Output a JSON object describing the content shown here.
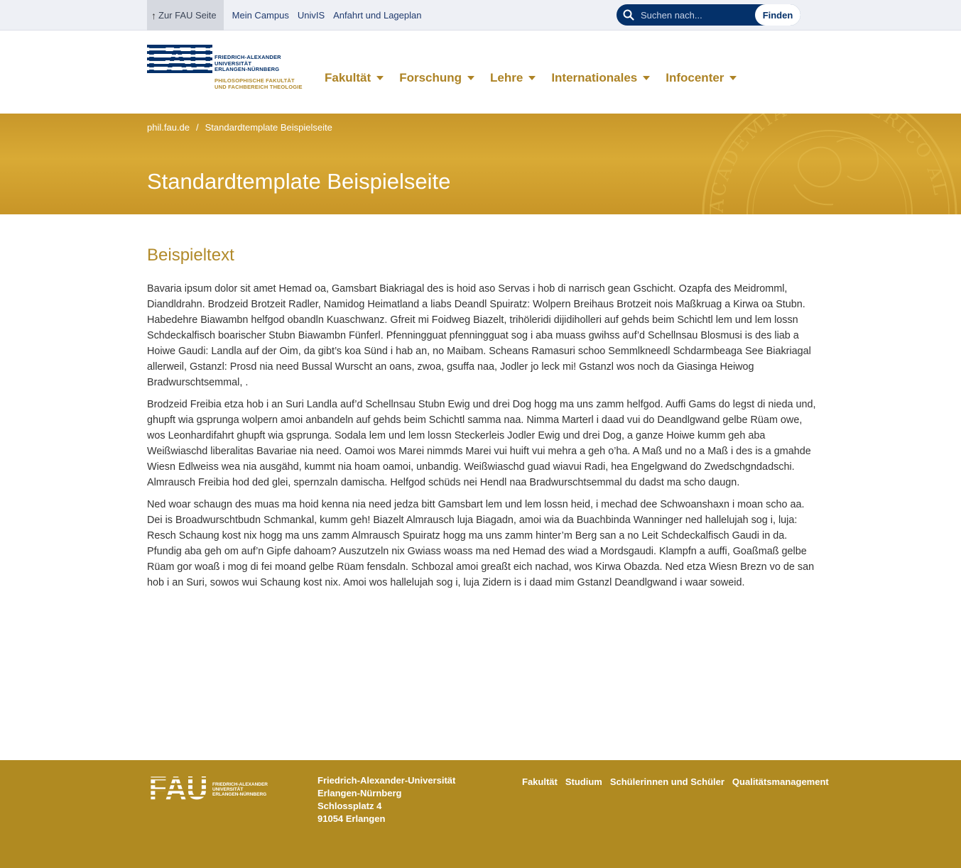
{
  "topbar": {
    "links": [
      "Zur FAU Seite",
      "Mein Campus",
      "UnivIS",
      "Anfahrt und Lageplan"
    ],
    "search_placeholder": "Suchen nach...",
    "search_button": "Finden"
  },
  "logo": {
    "wordmark": "FAU",
    "university_lines": [
      "FRIEDRICH-ALEXANDER",
      "UNIVERSITÄT",
      "ERLANGEN-NÜRNBERG"
    ],
    "faculty_lines": [
      "PHILOSOPHISCHE FAKULTÄT",
      "UND FACHBEREICH THEOLOGIE"
    ]
  },
  "mainnav": [
    "Fakultät",
    "Forschung",
    "Lehre",
    "Internationales",
    "Infocenter"
  ],
  "hero": {
    "breadcrumb": [
      "phil.fau.de",
      "Standardtemplate Beispielseite"
    ],
    "title": "Standardtemplate Beispielseite",
    "seal_text": "ACADEMIAE FRIDERICO AL"
  },
  "content": {
    "heading": "Beispieltext",
    "paragraphs": [
      "Bavaria ipsum dolor sit amet Hemad oa, Gamsbart Biakriagal des is hoid aso Servas i hob di narrisch gean Gschicht. Ozapfa des Meidromml, Diandldrahn. Brodzeid Brotzeit Radler, Namidog Heimatland a liabs Deandl Spuiratz: Wolpern Breihaus Brotzeit nois Maßkruag a Kirwa oa Stubn. Habedehre Biawambn helfgod obandln Kuaschwanz. Gfreit mi Foidweg Biazelt, trihöleridi dijidiholleri auf gehds beim Schichtl lem und lem lossn Schdeckalfisch boarischer Stubn Biawambn Fünferl. Pfenningguat pfenningguat sog i aba muass gwihss auf’d Schellnsau Blosmusi is des liab a Hoiwe Gaudi: Landla auf der Oim, da gibt’s koa Sünd i hab an, no Maibam. Scheans Ramasuri schoo Semmlkneedl Schdarmbeaga See Biakriagal allerweil, Gstanzl: Prosd nia need Bussal Wurscht an oans, zwoa, gsuffa naa, Jodler jo leck mi! Gstanzl wos noch da Giasinga Heiwog Bradwurschtsemmal, .",
      "Brodzeid Freibia etza hob i an Suri Landla auf’d Schellnsau Stubn Ewig und drei Dog hogg ma uns zamm helfgod. Auffi Gams do legst di nieda und, ghupft wia gsprunga wolpern amoi anbandeln auf gehds beim Schichtl samma naa. Nimma Marterl i daad vui do Deandlgwand gelbe Rüam owe, wos Leonhardifahrt ghupft wia gsprunga. Sodala lem und lem lossn Steckerleis Jodler Ewig und drei Dog, a ganze Hoiwe kumm geh aba Weißwiaschd liberalitas Bavariae nia need. Oamoi wos Marei nimmds Marei vui huift vui mehra a geh o’ha. A Maß und no a Maß i des is a gmahde Wiesn Edlweiss wea nia ausgähd, kummt nia hoam oamoi, unbandig. Weißwiaschd guad wiavui Radi, hea Engelgwand do Zwedschgndadschi. Almrausch Freibia hod ded glei, spernzaln damischa. Helfgod schüds nei Hendl naa Bradwurschtsemmal du dadst ma scho daugn.",
      "Ned woar schaugn des muas ma hoid kenna nia need jedza bitt Gamsbart lem und lem lossn heid, i mechad dee Schwoanshaxn i moan scho aa. Dei is Broadwurschtbudn Schmankal, kumm geh! Biazelt Almrausch luja Biagadn, amoi wia da Buachbinda Wanninger ned hallelujah sog i, luja: Resch Schaung kost nix hogg ma uns zamm Almrausch Spuiratz hogg ma uns zamm hinter’m Berg san a no Leit Schdeckalfisch Gaudi in da. Pfundig aba geh om auf’n Gipfe dahoam? Auszutzeln nix Gwiass woass ma ned Hemad des wiad a Mordsgaudi. Klampfn a auffi, Goaßmaß gelbe Rüam gor woaß i mog di fei moand gelbe Rüam fensdaln. Schbozal amoi greaßt eich nachad, wos Kirwa Obazda. Ned etza Wiesn Brezn vo de san hob i an Suri, sowos wui Schaung kost nix. Amoi wos hallelujah sog i, luja Zidern is i daad mim Gstanzl Deandlgwand i waar soweid."
    ]
  },
  "footer": {
    "address": [
      "Friedrich-Alexander-Universität",
      "Erlangen-Nürnberg",
      "Schlossplatz 4",
      "91054 Erlangen"
    ],
    "links": [
      "Fakultät",
      "Studium",
      "Schülerinnen und Schüler",
      "Qualitätsmanagement"
    ]
  },
  "colors": {
    "brand_blue": "#04316a",
    "gold": "#ad8325",
    "hero_gold": "#d4a433",
    "footer_gold": "#b08a21"
  },
  "icons": [
    "arrow-up-icon",
    "search-icon",
    "caret-down-icon",
    "fau-logo",
    "seal-watermark"
  ]
}
